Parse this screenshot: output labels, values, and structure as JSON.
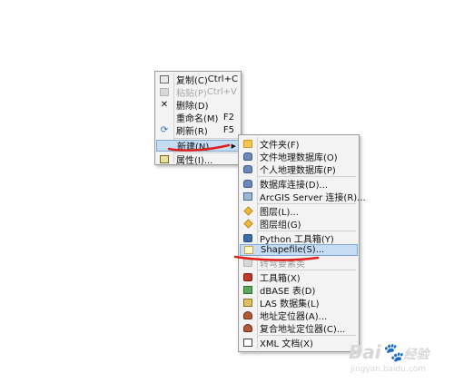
{
  "context_menu": {
    "items": [
      {
        "label": "复制(C)",
        "shortcut": "Ctrl+C",
        "icon": "copy-icon",
        "disabled": false
      },
      {
        "label": "粘贴(P)",
        "shortcut": "Ctrl+V",
        "icon": "paste-icon",
        "disabled": true
      },
      {
        "label": "删除(D)",
        "shortcut": "",
        "icon": "delete-icon",
        "disabled": false
      },
      {
        "label": "重命名(M)",
        "shortcut": "F2",
        "icon": "",
        "disabled": false
      },
      {
        "label": "刷新(R)",
        "shortcut": "F5",
        "icon": "refresh-icon",
        "disabled": false
      },
      {
        "label": "新建(N)",
        "shortcut": "",
        "icon": "",
        "disabled": false,
        "submenu": true,
        "highlighted": true
      },
      {
        "label": "属性(I)...",
        "shortcut": "",
        "icon": "properties-icon",
        "disabled": false
      }
    ]
  },
  "new_submenu": {
    "items": [
      {
        "label": "文件夹(F)",
        "icon": "folder-icon"
      },
      {
        "label": "文件地理数据库(O)",
        "icon": "file-geodatabase-icon"
      },
      {
        "label": "个人地理数据库(P)",
        "icon": "personal-geodatabase-icon"
      },
      {
        "label": "数据库连接(D)...",
        "icon": "database-connection-icon"
      },
      {
        "label": "ArcGIS Server 连接(R)...",
        "icon": "arcgis-server-icon"
      },
      {
        "label": "图层(L)...",
        "icon": "layer-icon"
      },
      {
        "label": "图层组(G)",
        "icon": "group-layer-icon"
      },
      {
        "label": "Python 工具箱(Y)",
        "icon": "python-toolbox-icon"
      },
      {
        "label": "Shapefile(S)...",
        "icon": "shapefile-icon",
        "highlighted": true
      },
      {
        "label": "转弯要素类",
        "icon": "turn-feature-class-icon"
      },
      {
        "label": "工具箱(X)",
        "icon": "toolbox-icon"
      },
      {
        "label": "dBASE 表(D)",
        "icon": "dbase-table-icon"
      },
      {
        "label": "LAS 数据集(L)",
        "icon": "las-dataset-icon"
      },
      {
        "label": "地址定位器(A)...",
        "icon": "address-locator-icon"
      },
      {
        "label": "复合地址定位器(C)...",
        "icon": "composite-locator-icon"
      },
      {
        "label": "XML 文档(X)",
        "icon": "xml-document-icon"
      }
    ]
  },
  "watermark": {
    "brand": "Bai",
    "suffix": "经验",
    "url": "jingyan.baidu.com"
  },
  "colors": {
    "menu_bg": "#f3f3f3",
    "highlight": "#c5dcf3",
    "annotation": "#e0201a"
  }
}
